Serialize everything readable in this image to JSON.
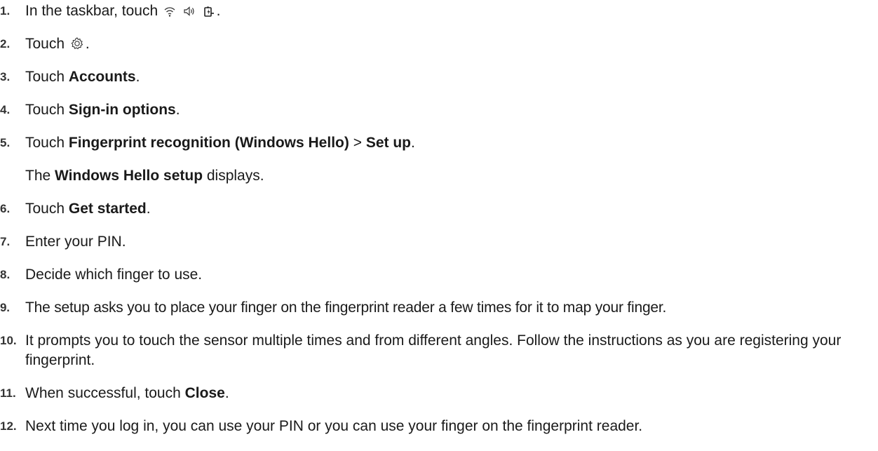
{
  "steps": [
    {
      "num": "1.",
      "pre": "In the taskbar, touch",
      "icons": [
        "wifi-icon",
        "speaker-icon",
        "battery-icon"
      ],
      "post": "."
    },
    {
      "num": "2.",
      "pre": "Touch",
      "icons": [
        "gear-icon"
      ],
      "post": "."
    },
    {
      "num": "3.",
      "pre": "Touch",
      "bold": "Accounts",
      "post": "."
    },
    {
      "num": "4.",
      "pre": "Touch",
      "bold": "Sign-in options",
      "post": "."
    },
    {
      "num": "5.",
      "pre": "Touch",
      "bold": "Fingerprint recognition (Windows Hello)",
      "mid": ">",
      "bold2": "Set up",
      "post": "."
    },
    {
      "num": "6.",
      "pre": "Touch",
      "bold": "Get started",
      "post": "."
    },
    {
      "num": "7.",
      "text": "Enter your PIN."
    },
    {
      "num": "8.",
      "text": "Decide which finger to use."
    },
    {
      "num": "9.",
      "text": "The setup asks you to place your finger on the fingerprint reader a few times for it to map your finger."
    },
    {
      "num": "10.",
      "text": "It prompts you to touch the sensor multiple times and from different angles. Follow the instructions as you are registering your fingerprint."
    },
    {
      "num": "11.",
      "pre": "When successful, touch",
      "bold": "Close",
      "post": "."
    },
    {
      "num": "12.",
      "text": "Next time you log in, you can use your PIN or you can use your finger on the fingerprint reader."
    }
  ],
  "note5": {
    "pre": "The",
    "bold": "Windows Hello setup",
    "post": "displays."
  }
}
